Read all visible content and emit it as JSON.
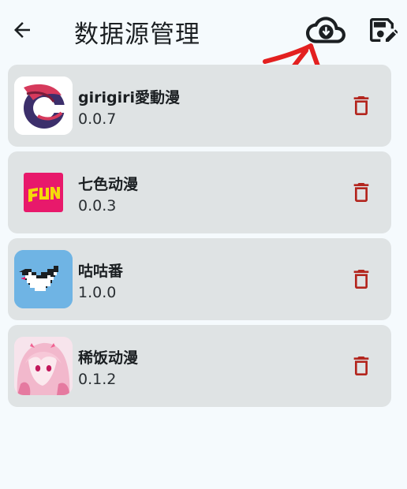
{
  "appbar": {
    "title": "数据源管理",
    "back_icon": "arrow-back-icon",
    "import_icon": "cloud-download-icon",
    "save_icon": "save-edit-icon"
  },
  "sources": [
    {
      "name": "girigiri愛動漫",
      "version": "0.0.7",
      "icon": "girigiri-logo"
    },
    {
      "name": "七色动漫",
      "version": "0.0.3",
      "icon": "fun-logo"
    },
    {
      "name": "咕咕番",
      "version": "1.0.0",
      "icon": "pixel-bird-logo"
    },
    {
      "name": "稀饭动漫",
      "version": "0.1.2",
      "icon": "anime-girl-logo"
    }
  ],
  "colors": {
    "background": "#f5fafd",
    "card": "#dfe3e4",
    "delete": "#b3261e",
    "annotation": "#e32020"
  }
}
